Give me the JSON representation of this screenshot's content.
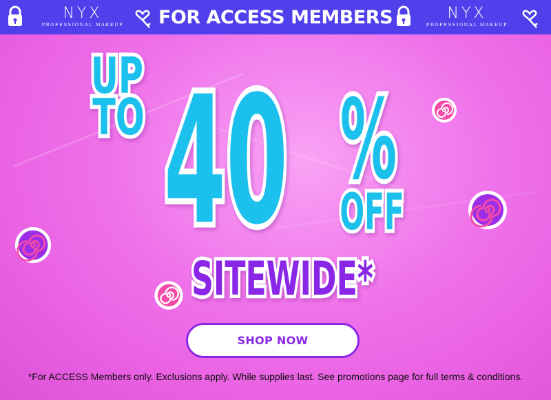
{
  "topbar": {
    "headline": "FOR ACCESS MEMBERS",
    "logo_word": "NYX",
    "logo_sub": "PROFESSIONAL MAKEUP"
  },
  "promo": {
    "up": "UP",
    "to": "TO",
    "amount": "40",
    "percent": "%",
    "off": "OFF",
    "scope": "SITEWIDE*"
  },
  "cta": {
    "label": "SHOP NOW"
  },
  "disclaimer": "*For ACCESS Members only. Exclusions apply. While supplies last. See promotions page for full terms & conditions.",
  "colors": {
    "topbar": "#4f40ec",
    "cyan": "#1fc0ec",
    "purple": "#8a28e6",
    "pink_bg": "#ef72ea"
  }
}
